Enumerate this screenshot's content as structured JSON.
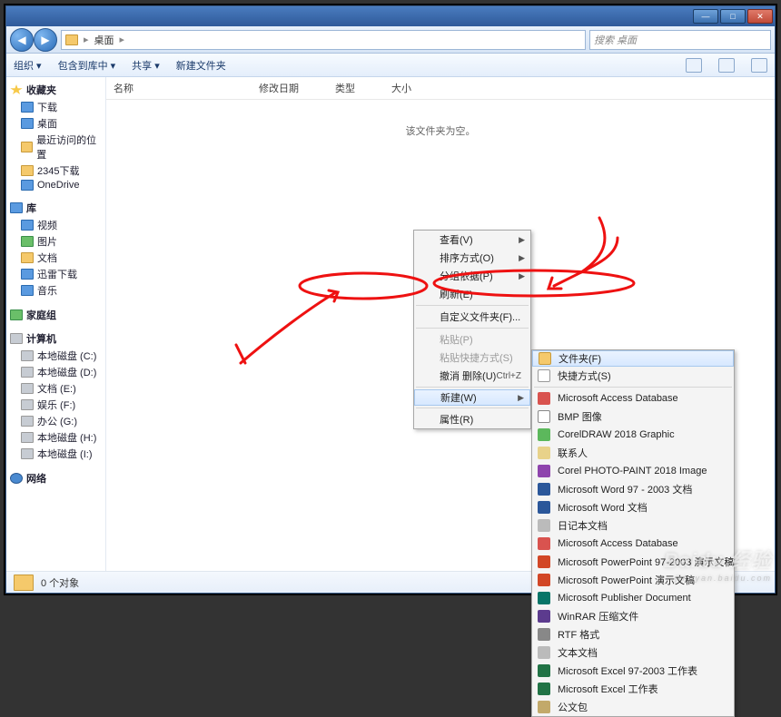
{
  "titlebar": {
    "min": "—",
    "max": "□",
    "close": "✕"
  },
  "nav": {
    "back": "◀",
    "fwd": "▶",
    "path_label": "桌面",
    "path_sep": "▸",
    "search_placeholder": "搜索 桌面"
  },
  "toolbar": {
    "organize": "组织 ▾",
    "include": "包含到库中 ▾",
    "share": "共享 ▾",
    "newfolder": "新建文件夹"
  },
  "columns": {
    "name": "名称",
    "date": "修改日期",
    "type": "类型",
    "size": "大小"
  },
  "empty_text": "该文件夹为空。",
  "sidebar": {
    "fav": {
      "head": "收藏夹",
      "items": [
        "下载",
        "桌面",
        "最近访问的位置",
        "2345下载",
        "OneDrive"
      ]
    },
    "lib": {
      "head": "库",
      "items": [
        "视频",
        "图片",
        "文档",
        "迅雷下载",
        "音乐"
      ]
    },
    "home": {
      "head": "家庭组"
    },
    "pc": {
      "head": "计算机",
      "items": [
        "本地磁盘 (C:)",
        "本地磁盘 (D:)",
        "文档 (E:)",
        "娱乐 (F:)",
        "办公 (G:)",
        "本地磁盘 (H:)",
        "本地磁盘 (I:)"
      ]
    },
    "net": {
      "head": "网络"
    }
  },
  "menu1": {
    "view": "查看(V)",
    "sort": "排序方式(O)",
    "group": "分组依据(P)",
    "refresh": "刷新(E)",
    "customize": "自定义文件夹(F)...",
    "paste": "粘贴(P)",
    "paste_shortcut": "粘贴快捷方式(S)",
    "undo": "撤消 删除(U)",
    "undo_key": "Ctrl+Z",
    "new": "新建(W)",
    "props": "属性(R)"
  },
  "menu2": {
    "folder": "文件夹(F)",
    "shortcut": "快捷方式(S)",
    "items": [
      {
        "ico": "mico-red",
        "label": "Microsoft Access Database"
      },
      {
        "ico": "mico-bmp",
        "label": "BMP 图像"
      },
      {
        "ico": "mico-cdr",
        "label": "CorelDRAW 2018 Graphic"
      },
      {
        "ico": "mico-contact",
        "label": "联系人"
      },
      {
        "ico": "mico-cpp",
        "label": "Corel PHOTO-PAINT 2018 Image"
      },
      {
        "ico": "mico-doc",
        "label": "Microsoft Word 97 - 2003 文档"
      },
      {
        "ico": "mico-doc",
        "label": "Microsoft Word 文档"
      },
      {
        "ico": "mico-txt",
        "label": "日记本文档"
      },
      {
        "ico": "mico-red",
        "label": "Microsoft Access Database"
      },
      {
        "ico": "mico-ppt",
        "label": "Microsoft PowerPoint 97-2003 演示文稿"
      },
      {
        "ico": "mico-ppt",
        "label": "Microsoft PowerPoint 演示文稿"
      },
      {
        "ico": "mico-pub",
        "label": "Microsoft Publisher Document"
      },
      {
        "ico": "mico-rar",
        "label": "WinRAR 压缩文件"
      },
      {
        "ico": "mico-rtf",
        "label": "RTF 格式"
      },
      {
        "ico": "mico-txt",
        "label": "文本文档"
      },
      {
        "ico": "mico-xls",
        "label": "Microsoft Excel 97-2003 工作表"
      },
      {
        "ico": "mico-xls",
        "label": "Microsoft Excel 工作表"
      },
      {
        "ico": "mico-brief",
        "label": "公文包"
      }
    ]
  },
  "status": {
    "text": "0 个对象"
  },
  "watermark": {
    "main": "Baidu 经验",
    "sub": "jingyan.baidu.com"
  }
}
